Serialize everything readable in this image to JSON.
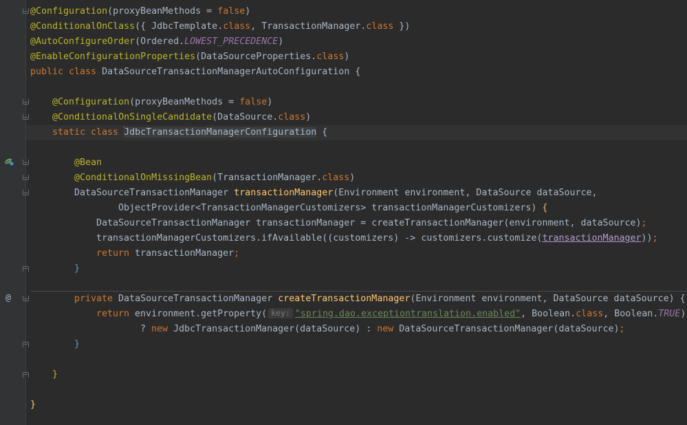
{
  "gutter": {
    "bean_icon": "spring-bean-icon",
    "override_icon": "at-override-icon",
    "override_symbol": "@",
    "bulb_icon": "lightbulb-icon"
  },
  "code": {
    "l1_ann": "@Configuration",
    "l1_a": "(proxyBeanMethods = ",
    "l1_kw": "false",
    "l1_b": ")",
    "l2_ann": "@ConditionalOnClass",
    "l2_a": "({ JdbcTemplate.",
    "l2_kw1": "class",
    "l2_b": ", TransactionManager.",
    "l2_kw2": "class",
    "l2_c": " })",
    "l3_ann": "@AutoConfigureOrder",
    "l3_a": "(Ordered.",
    "l3_const": "LOWEST_PRECEDENCE",
    "l3_b": ")",
    "l4_ann": "@EnableConfigurationProperties",
    "l4_a": "(DataSourceProperties.",
    "l4_kw": "class",
    "l4_b": ")",
    "l5_kw": "public class ",
    "l5_a": "DataSourceTransactionManagerAutoConfiguration {",
    "l7_ann": "@Configuration",
    "l7_a": "(proxyBeanMethods = ",
    "l7_kw": "false",
    "l7_b": ")",
    "l8_ann": "@ConditionalOnSingleCandidate",
    "l8_a": "(DataSource.",
    "l8_kw": "class",
    "l8_b": ")",
    "l9_kw": "static class ",
    "l9_a": "JdbcTransactionManagerConfiguration",
    "l9_b": " {",
    "l11_ann": "@Bean",
    "l12_ann": "@ConditionalOnMissingBean",
    "l12_a": "(TransactionManager.",
    "l12_kw": "class",
    "l12_b": ")",
    "l13_a": "DataSourceTransactionManager ",
    "l13_fn": "transactionManager",
    "l13_b": "(Environment environment, DataSource dataSource,",
    "l14_a": "ObjectProvider<TransactionManagerCustomizers> transactionManagerCustomizers) ",
    "l14_brace": "{",
    "l15_a": "DataSourceTransactionManager transactionManager = createTransactionManager(environment, dataSource)",
    "l15_semi": ";",
    "l16_a": "transactionManagerCustomizers.ifAvailable((customizers) -> customizers.customize(",
    "l16_field": "transactionManager",
    "l16_b": "))",
    "l16_semi": ";",
    "l17_kw": "return ",
    "l17_a": "transactionManager",
    "l17_semi": ";",
    "l18_brace": "}",
    "l20_kw": "private ",
    "l20_a": "DataSourceTransactionManager ",
    "l20_fn": "createTransactionManager",
    "l20_b": "(Environment environment, DataSource dataSource) {",
    "l21_kw": "return ",
    "l21_a": "environment.getProperty(",
    "l21_hint": "key:",
    "l21_str": "\"spring.dao.exceptiontranslation.enabled\"",
    "l21_b": ", Boolean.",
    "l21_kw2": "class",
    "l21_c": ", Boolean.",
    "l21_const": "TRUE",
    "l21_d": ")",
    "l22_a": "? ",
    "l22_kw": "new ",
    "l22_b": "JdbcTransactionManager(dataSource) : ",
    "l22_kw2": "new ",
    "l22_c": "DataSourceTransactionManager(dataSource)",
    "l22_semi": ";",
    "l23_brace": "}",
    "l25_brace": "}",
    "l27_brace": "}"
  }
}
